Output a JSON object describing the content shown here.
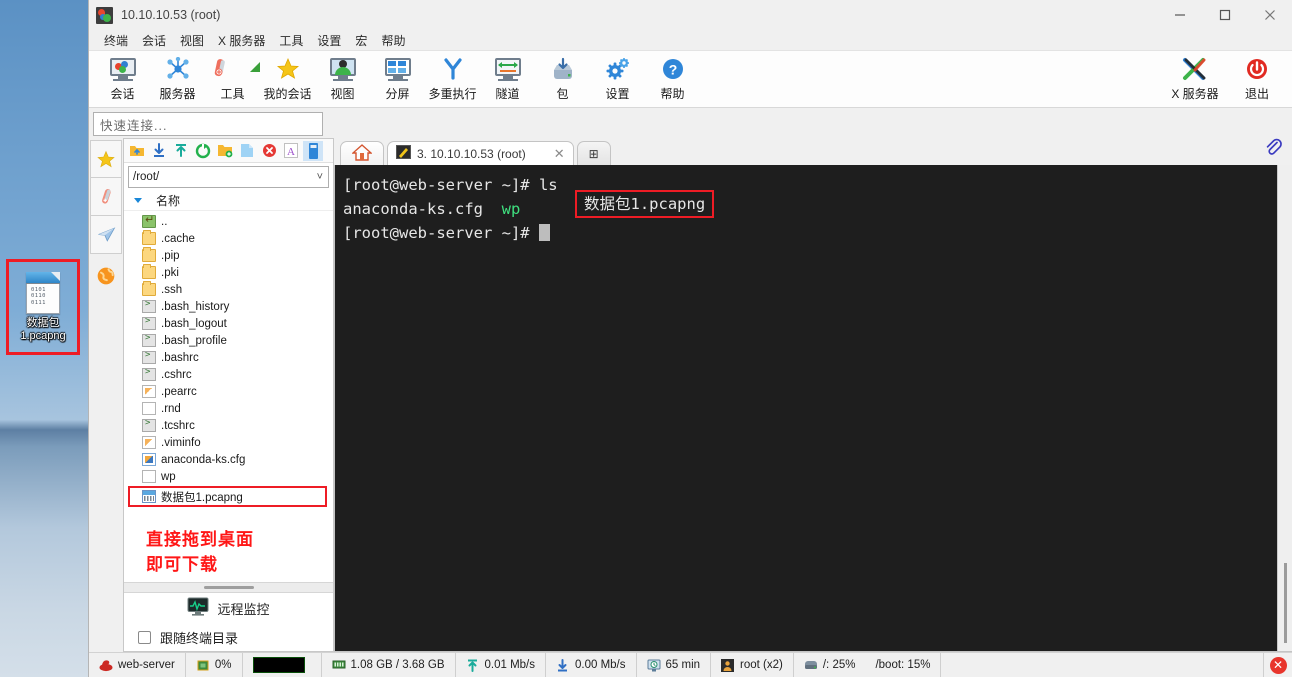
{
  "desktop": {
    "icon": {
      "name": "数据包1.pcapng",
      "label_line1": "数据包",
      "label_line2": "1.pcapng",
      "bits": [
        "0101",
        "0110",
        "0111"
      ]
    }
  },
  "window": {
    "title": "10.10.10.53 (root)",
    "controls": {
      "minimize": "—",
      "maximize": "□",
      "close": "✕"
    }
  },
  "menu": {
    "items": [
      "终端",
      "会话",
      "视图",
      "X 服务器",
      "工具",
      "设置",
      "宏",
      "帮助"
    ]
  },
  "toolbar": {
    "items": [
      {
        "label": "会话",
        "icon": "session-monitor-icon"
      },
      {
        "label": "服务器",
        "icon": "servers-network-icon"
      },
      {
        "label": "工具",
        "icon": "tools-knife-icon"
      },
      {
        "label": "我的会话",
        "icon": "star-icon"
      },
      {
        "label": "视图",
        "icon": "view-monitor-icon"
      },
      {
        "label": "分屏",
        "icon": "split-screen-icon"
      },
      {
        "label": "多重执行",
        "icon": "multi-exec-icon"
      },
      {
        "label": "隧道",
        "icon": "tunnel-icon"
      },
      {
        "label": "包",
        "icon": "packages-download-icon"
      },
      {
        "label": "设置",
        "icon": "settings-gear-icon"
      },
      {
        "label": "帮助",
        "icon": "help-question-icon"
      }
    ],
    "right_items": [
      {
        "label": "X 服务器",
        "icon": "x-server-icon"
      },
      {
        "label": "退出",
        "icon": "power-exit-icon"
      }
    ]
  },
  "quick_connect": {
    "placeholder": "快速连接..."
  },
  "rail": {
    "buttons": [
      {
        "icon": "star-icon",
        "name": "favorites"
      },
      {
        "icon": "tools-knife-icon",
        "name": "tools"
      },
      {
        "icon": "paper-plane-icon",
        "name": "send"
      },
      {
        "icon": "globe-icon",
        "name": "web"
      }
    ]
  },
  "sftp": {
    "toolbar_icons": [
      "go-up-folder-icon",
      "download-icon",
      "upload-icon",
      "refresh-icon",
      "new-folder-icon",
      "new-file-icon",
      "delete-icon",
      "rename-icon",
      "usb-icon"
    ],
    "path": "/root/",
    "column_header": "名称",
    "files": [
      {
        "name": "..",
        "type": "up"
      },
      {
        "name": ".cache",
        "type": "folder"
      },
      {
        "name": ".pip",
        "type": "folder"
      },
      {
        "name": ".pki",
        "type": "folder"
      },
      {
        "name": ".ssh",
        "type": "folder"
      },
      {
        "name": ".bash_history",
        "type": "sh"
      },
      {
        "name": ".bash_logout",
        "type": "sh"
      },
      {
        "name": ".bash_profile",
        "type": "sh"
      },
      {
        "name": ".bashrc",
        "type": "sh"
      },
      {
        "name": ".cshrc",
        "type": "sh"
      },
      {
        "name": ".pearrc",
        "type": "txt"
      },
      {
        "name": ".rnd",
        "type": "doc"
      },
      {
        "name": ".tcshrc",
        "type": "sh"
      },
      {
        "name": ".viminfo",
        "type": "txt"
      },
      {
        "name": "anaconda-ks.cfg",
        "type": "cfg"
      },
      {
        "name": "wp",
        "type": "doc"
      }
    ],
    "highlighted_file": {
      "name": "数据包1.pcapng",
      "type": "pcap"
    },
    "note_lines": [
      "直接拖到桌面",
      "即可下载"
    ],
    "remote_monitor": "远程监控",
    "follow_terminal": "跟随终端目录",
    "follow_checked": false
  },
  "tabs": {
    "home_icon": "home-icon",
    "items": [
      {
        "label": "3. 10.10.10.53 (root)",
        "icon": "terminal-pencil-icon",
        "active": true,
        "close": "✕"
      }
    ],
    "add_label": "⊞",
    "clip_icon": "paperclip-icon"
  },
  "terminal": {
    "lines": [
      {
        "parts": [
          {
            "text": "[root@web-server ~]# ls",
            "color": "default"
          }
        ]
      },
      {
        "parts": [
          {
            "text": "anaconda-ks.cfg  ",
            "color": "default"
          },
          {
            "text": "wp",
            "color": "green"
          }
        ]
      },
      {
        "parts": [
          {
            "text": "[root@web-server ~]# ",
            "color": "default"
          }
        ]
      }
    ],
    "highlighted_output": "数据包1.pcapng",
    "prompt": "[root@web-server ~]#",
    "command": "ls",
    "colors": {
      "background": "#1e1e1e",
      "foreground": "#e6e6e6",
      "green": "#3fe07f",
      "highlight": "#ee1c25"
    }
  },
  "statusbar": {
    "items": [
      {
        "icon": "redhat-icon",
        "label": "web-server"
      },
      {
        "icon": "cpu-icon",
        "label": "0%"
      },
      {
        "icon": "graph-icon",
        "label": ""
      },
      {
        "icon": "ram-icon",
        "label": "1.08 GB / 3.68 GB"
      },
      {
        "icon": "upload-icon",
        "label": "0.01 Mb/s"
      },
      {
        "icon": "download-icon",
        "label": "0.00 Mb/s"
      },
      {
        "icon": "clock-icon",
        "label": "65 min"
      },
      {
        "icon": "user-icon",
        "label": "root (x2)"
      },
      {
        "icon": "disk-icon",
        "label": "/: 25%"
      },
      {
        "icon": "",
        "label": "/boot: 15%"
      }
    ],
    "close_button": "✕"
  }
}
